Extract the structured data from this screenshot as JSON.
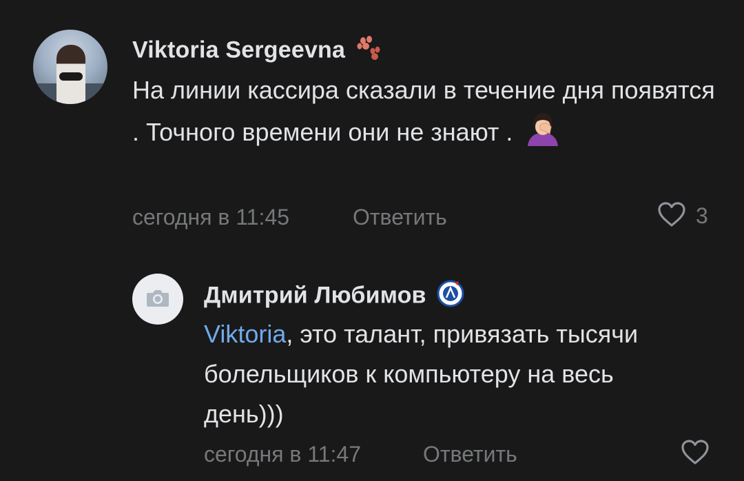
{
  "comments": [
    {
      "author": "Viktoria Sergeevna",
      "author_badge_icon": "paw-icon",
      "text": "На линии кассира сказали в течение дня появятся . Точного времени они не знают .",
      "emoji_icon": "facepalm-emoji",
      "time": "сегодня в 11:45",
      "reply_label": "Ответить",
      "likes": "3"
    },
    {
      "author": "Дмитрий Любимов",
      "author_badge_icon": "team-logo-icon",
      "mention": "Viktoria",
      "text": ", это талант, привязать тысячи болельщиков к компьютеру на весь день)))",
      "time": "сегодня в 11:47",
      "reply_label": "Ответить"
    }
  ],
  "colors": {
    "background": "#19191a",
    "text": "#e1e3e6",
    "secondary": "#76787a",
    "mention": "#71aaeb"
  }
}
